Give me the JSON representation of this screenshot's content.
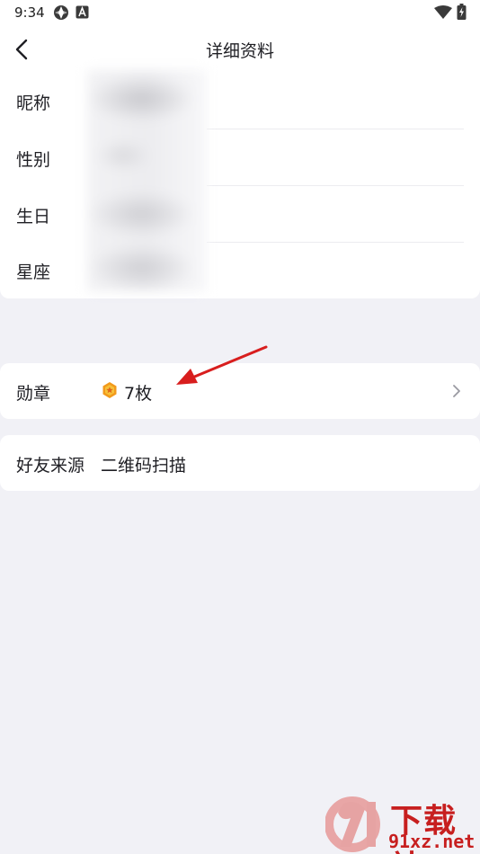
{
  "status_bar": {
    "time": "9:34",
    "icons": [
      "app-notification-icon",
      "a-notification-icon",
      "wifi-icon",
      "battery-charging-icon"
    ]
  },
  "header": {
    "title": "详细资料",
    "back_icon": "chevron-left-icon"
  },
  "profile_info": {
    "rows": [
      {
        "label": "昵称"
      },
      {
        "label": "性别"
      },
      {
        "label": "生日"
      },
      {
        "label": "星座"
      }
    ]
  },
  "medal": {
    "label": "勋章",
    "count": "7枚",
    "icon": "medal-icon",
    "chevron": "chevron-right-icon"
  },
  "friend_source": {
    "label": "好友来源",
    "value": "二维码扫描"
  },
  "watermark": {
    "logo_text": "91",
    "text_top": "下载站",
    "text_bottom": "91xz.net"
  },
  "colors": {
    "background": "#f1f1f6",
    "card": "#ffffff",
    "text": "#1f1f24",
    "arrow": "#d81e1e",
    "medal_orange": "#f29a1c",
    "watermark_red": "#c71f1f"
  }
}
